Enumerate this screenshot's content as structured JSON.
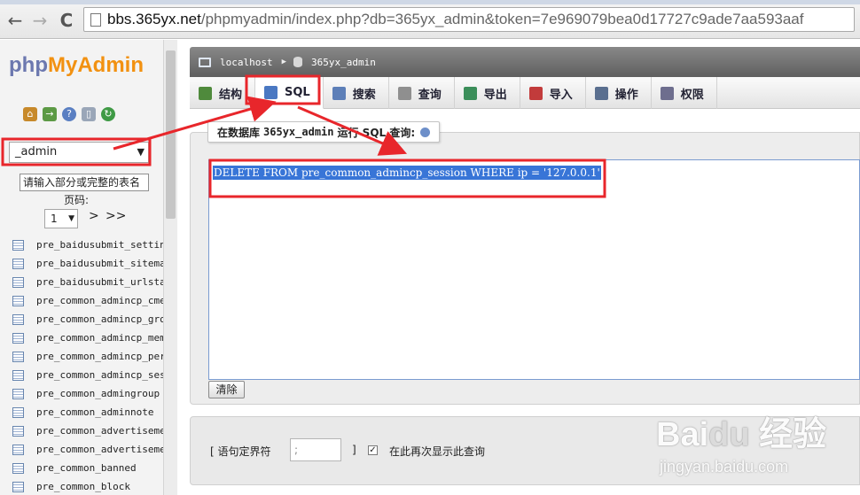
{
  "browser": {
    "url_host": "bbs.365yx.net",
    "url_rest": "/phpmyadmin/index.php?db=365yx_admin&token=7e969079bea0d17727c9ade7aa593aaf",
    "back_glyph": "←",
    "forward_glyph": "→",
    "reload_glyph": "C"
  },
  "sidebar": {
    "logo_php": "php",
    "logo_myadmin": "MyAdmin",
    "quick_icons": [
      "home-icon",
      "logout-icon",
      "help-icon",
      "docs-icon",
      "reload-icon"
    ],
    "db_selected": "_admin",
    "filter_placeholder": "请输入部分或完整的表名",
    "page_label": "页码:",
    "page_selected": "1",
    "page_next": ">",
    "page_last": ">>",
    "tables": [
      "pre_baidusubmit_setting",
      "pre_baidusubmit_sitemap",
      "pre_baidusubmit_urlstat",
      "pre_common_admincp_cmenu",
      "pre_common_admincp_group",
      "pre_common_admincp_member",
      "pre_common_admincp_perm",
      "pre_common_admincp_session",
      "pre_common_admingroup",
      "pre_common_adminnote",
      "pre_common_advertisement",
      "pre_common_advertisement_custom",
      "pre_common_banned",
      "pre_common_block"
    ]
  },
  "breadcrumb": {
    "server": "localhost",
    "database": "365yx_admin"
  },
  "tabs": [
    {
      "label": "结构",
      "icon": "structure-icon",
      "color": "#4f8a3c",
      "active": false
    },
    {
      "label": "SQL",
      "icon": "sql-icon",
      "color": "#4a78c2",
      "active": true
    },
    {
      "label": "搜索",
      "icon": "search-icon",
      "color": "#5d7fb8",
      "active": false
    },
    {
      "label": "查询",
      "icon": "query-icon",
      "color": "#8f8f8f",
      "active": false
    },
    {
      "label": "导出",
      "icon": "export-icon",
      "color": "#3b8e5a",
      "active": false
    },
    {
      "label": "导入",
      "icon": "import-icon",
      "color": "#c23b3b",
      "active": false
    },
    {
      "label": "操作",
      "icon": "operations-icon",
      "color": "#5a6f8f",
      "active": false
    },
    {
      "label": "权限",
      "icon": "privileges-icon",
      "color": "#6e6e8e",
      "active": false
    }
  ],
  "sql_panel": {
    "legend_prefix": "在数据库",
    "legend_db": "365yx_admin",
    "legend_suffix": "运行 SQL 查询:",
    "query": "DELETE FROM pre_common_admincp_session WHERE ip = '127.0.0.1'",
    "clear_label": "清除"
  },
  "bottom": {
    "delimiter_label": "[ 语句定界符",
    "delimiter_value": ";",
    "delimiter_close": "]",
    "show_again_label": "在此再次显示此查询",
    "show_again_checked": "✓"
  },
  "watermark": {
    "main": "Bai",
    "paw": "du",
    "cn": "经验",
    "sub": "jingyan.baidu.com"
  },
  "colors": {
    "annotation_red": "#e8262b",
    "accent": "#3875d7"
  }
}
